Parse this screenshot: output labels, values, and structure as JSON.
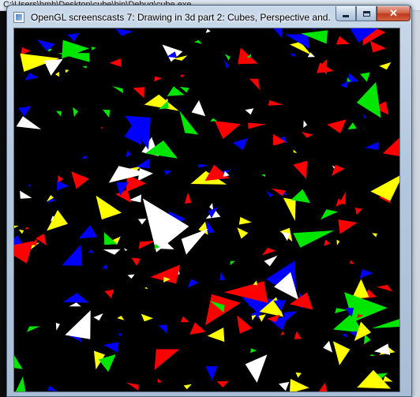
{
  "console": {
    "title": "C:\\Users\\hmh\\Desktop\\cube\\bin\\Debug\\cube.exe"
  },
  "window": {
    "title": "OpenGL screenscasts 7: Drawing in 3d part 2: Cubes, Perspective and...",
    "close_glyph": "✕"
  },
  "scene": {
    "background": "#000000",
    "colors": [
      "#ff0000",
      "#00e600",
      "#ffff00",
      "#ffffff",
      "#0000ff"
    ],
    "shape": "triangle",
    "description_count_visual": "many"
  }
}
